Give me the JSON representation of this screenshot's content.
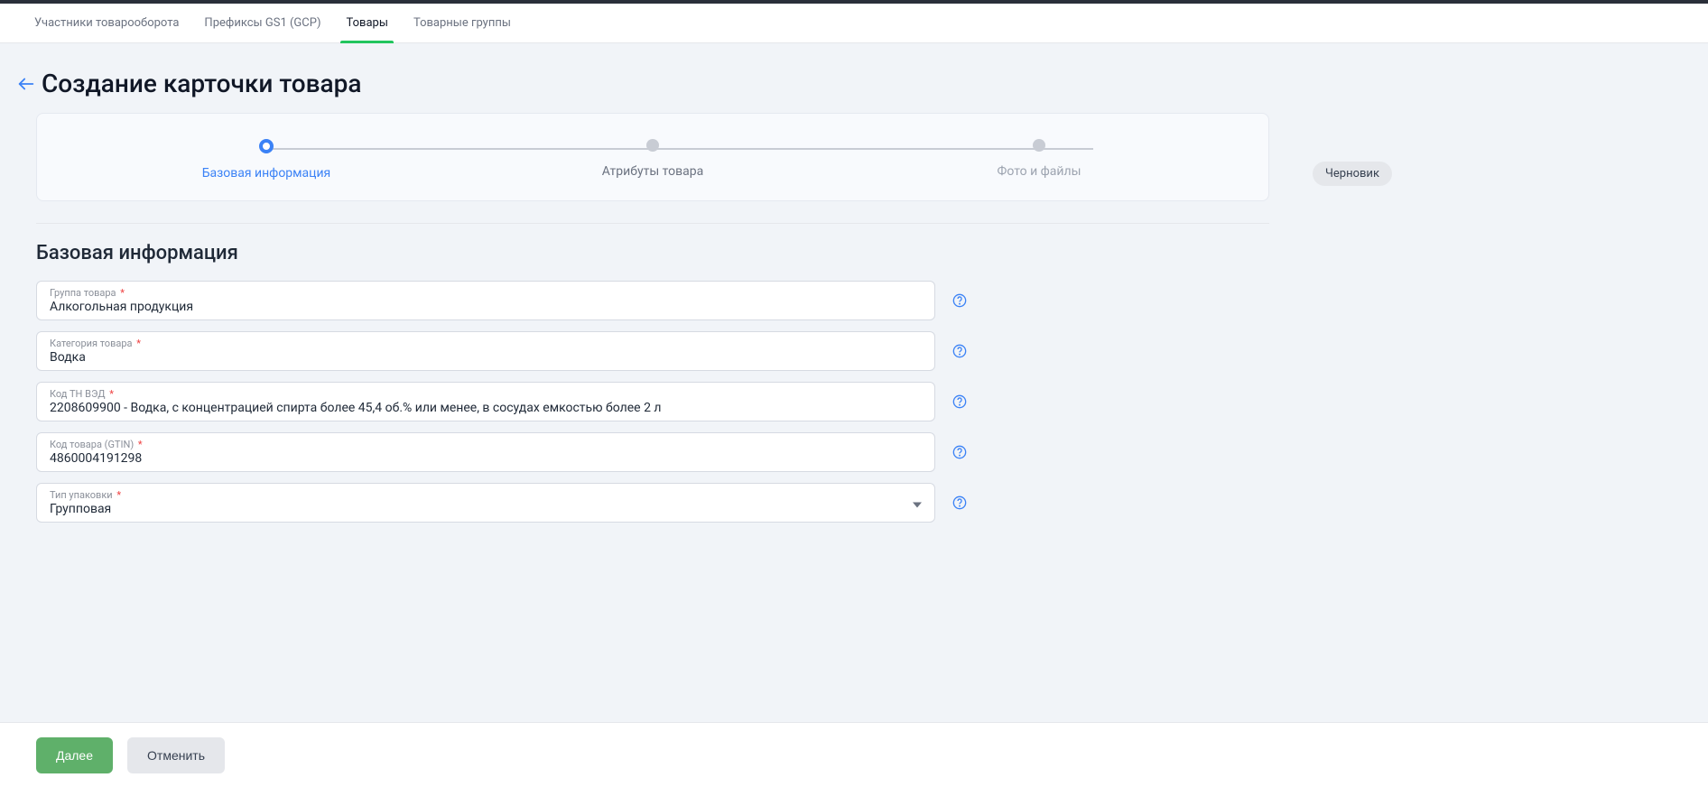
{
  "tabs": [
    {
      "label": "Участники товарооборота",
      "active": false
    },
    {
      "label": "Префиксы GS1 (GCP)",
      "active": false
    },
    {
      "label": "Товары",
      "active": true
    },
    {
      "label": "Товарные группы",
      "active": false
    }
  ],
  "page_title": "Создание карточки товара",
  "stepper": {
    "steps": [
      {
        "label": "Базовая информация",
        "state": "active"
      },
      {
        "label": "Атрибуты товара",
        "state": "normal"
      },
      {
        "label": "Фото и файлы",
        "state": "disabled"
      }
    ]
  },
  "status_badge": "Черновик",
  "section_title": "Базовая информация",
  "fields": {
    "group": {
      "label": "Группа товара",
      "value": "Алкогольная продукция"
    },
    "category": {
      "label": "Категория товара",
      "value": "Водка"
    },
    "tnved": {
      "label": "Код ТН ВЭД",
      "value": "2208609900 - Водка, с концентрацией спирта более 45,4 об.% или менее, в сосудах емкостью более 2 л"
    },
    "gtin": {
      "label": "Код товара (GTIN)",
      "value": "4860004191298"
    },
    "package": {
      "label": "Тип упаковки",
      "value": "Групповая"
    }
  },
  "footer": {
    "next": "Далее",
    "cancel": "Отменить"
  }
}
